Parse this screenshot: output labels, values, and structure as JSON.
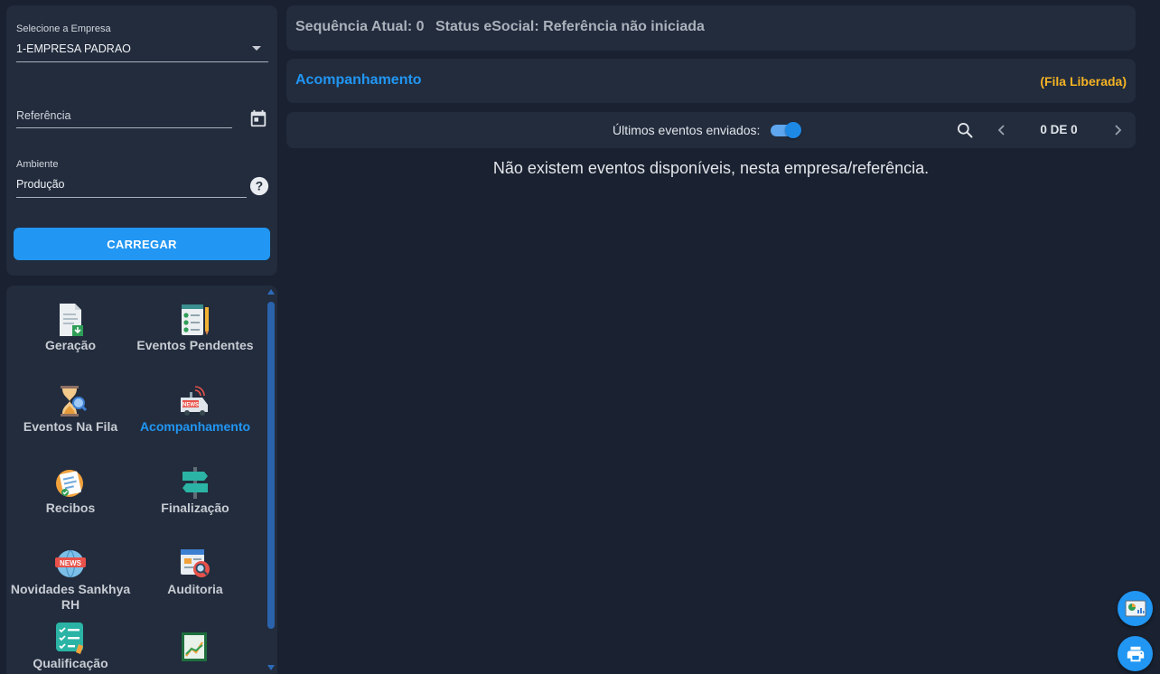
{
  "form": {
    "company_label": "Selecione a Empresa",
    "company_value": "1-EMPRESA PADRAO",
    "reference_placeholder": "Referência",
    "environment_label": "Ambiente",
    "environment_value": "Produção",
    "load_button": "CARREGAR"
  },
  "nav": {
    "items": [
      {
        "label": "Geração",
        "icon": "document-download-icon",
        "active": false
      },
      {
        "label": "Eventos Pendentes",
        "icon": "checklist-pencil-icon",
        "active": false
      },
      {
        "label": "Eventos Na Fila",
        "icon": "hourglass-search-icon",
        "active": false
      },
      {
        "label": "Acompanhamento",
        "icon": "news-van-icon",
        "active": true
      },
      {
        "label": "Recibos",
        "icon": "receipt-icon",
        "active": false
      },
      {
        "label": "Finalização",
        "icon": "signpost-icon",
        "active": false
      },
      {
        "label": "Novidades Sankhya RH",
        "icon": "news-globe-icon",
        "active": false
      },
      {
        "label": "Auditoria",
        "icon": "audit-search-icon",
        "active": false
      },
      {
        "label": "Qualificação",
        "icon": "qualification-checklist-icon",
        "active": false
      },
      {
        "label": "",
        "icon": "chart-book-icon",
        "active": false
      }
    ]
  },
  "status": {
    "sequence": "Sequência Atual: 0",
    "esocial": "Status eSocial: Referência não iniciada"
  },
  "tab": {
    "title": "Acompanhamento",
    "queue_status": "(Fila Liberada)"
  },
  "toolbar": {
    "last_events_label": "Últimos eventos enviados:",
    "toggle_on": true,
    "page_counter": "0 DE 0"
  },
  "empty_message": "Não existem eventos disponíveis, nesta empresa/referência.",
  "colors": {
    "background": "#1a2130",
    "panel": "#222c3d",
    "accent": "#2196f3",
    "warning": "#f5b323"
  }
}
